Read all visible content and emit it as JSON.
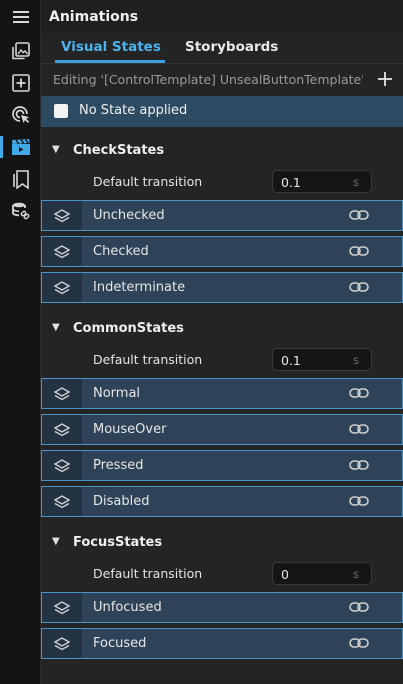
{
  "panel": {
    "title": "Animations"
  },
  "activity_bar": {
    "items": [
      {
        "icon": "hamburger-menu-icon"
      },
      {
        "icon": "image-gallery-icon"
      },
      {
        "icon": "add-box-icon"
      },
      {
        "icon": "target-touch-icon"
      },
      {
        "icon": "animation-clapper-icon",
        "active": true
      },
      {
        "icon": "bookmarks-icon"
      },
      {
        "icon": "database-link-icon"
      }
    ]
  },
  "tabs": [
    {
      "label": "Visual States",
      "active": true
    },
    {
      "label": "Storyboards",
      "active": false
    }
  ],
  "editing": {
    "text": "Editing '[ControlTemplate] UnsealButtonTemplate' St...",
    "add_label": "+"
  },
  "no_state": {
    "label": "No State applied",
    "checked": false
  },
  "groups": [
    {
      "name": "CheckStates",
      "transition_label": "Default transition",
      "transition_value": "0.1",
      "transition_unit": "s",
      "states": [
        "Unchecked",
        "Checked",
        "Indeterminate"
      ]
    },
    {
      "name": "CommonStates",
      "transition_label": "Default transition",
      "transition_value": "0.1",
      "transition_unit": "s",
      "states": [
        "Normal",
        "MouseOver",
        "Pressed",
        "Disabled"
      ]
    },
    {
      "name": "FocusStates",
      "transition_label": "Default transition",
      "transition_value": "0",
      "transition_unit": "s",
      "states": [
        "Unfocused",
        "Focused"
      ]
    }
  ],
  "colors": {
    "accent": "#3ba0e0",
    "state_row_bg": "#2f4358",
    "state_row_border": "#4a93c8",
    "selected_bar": "#2d4a63"
  }
}
